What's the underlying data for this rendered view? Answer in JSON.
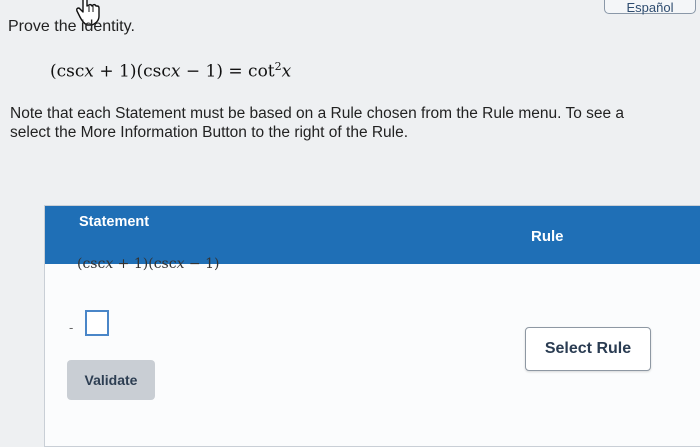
{
  "language_button": {
    "label": "Español"
  },
  "problem": {
    "prompt": "Prove the identity.",
    "identity": {
      "lhs_open": "(csc",
      "var1": "x",
      "lhs_mid": " + 1)(csc",
      "var2": "x",
      "lhs_close": " − 1) = cot",
      "exponent": "2",
      "var3": "x"
    },
    "note_line1": "Note that each Statement must be based on a Rule chosen from the Rule menu. To see a",
    "note_line2": "select the More Information Button to the right of the Rule."
  },
  "table": {
    "header_statement": "Statement",
    "header_rule": "Rule",
    "row1": {
      "open": "(csc",
      "var1": "x",
      "mid": " + 1)(csc",
      "var2": "x",
      "close": " − 1)"
    },
    "row2_prefix": "-",
    "select_rule_label": "Select Rule"
  },
  "validate_label": "Validate"
}
